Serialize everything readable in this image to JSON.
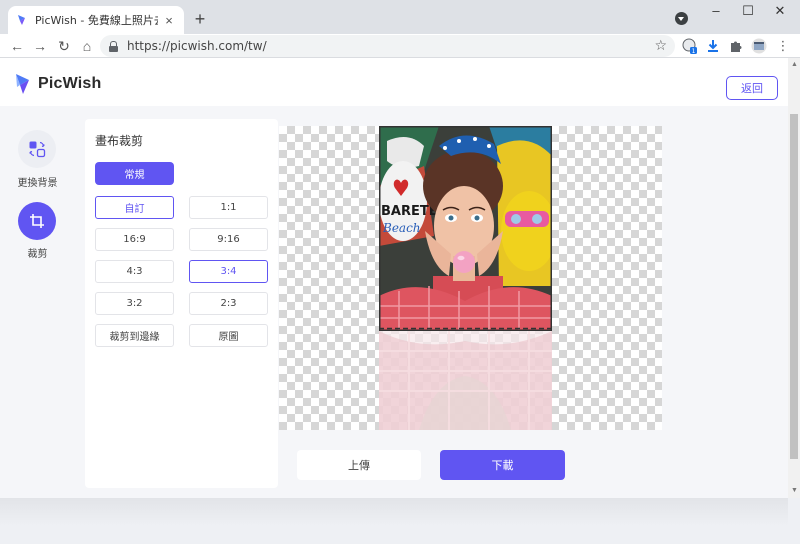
{
  "browser": {
    "tab_title": "PicWish - 免費線上照片去背，超",
    "tab_close": "×",
    "new_tab": "+",
    "url": "https://picwish.com/tw/",
    "nav": {
      "back": "←",
      "forward": "→",
      "reload": "↻",
      "home": "⌂"
    },
    "window": {
      "minimize": "–",
      "maximize": "☐",
      "close": "✕"
    },
    "star": "☆",
    "ext_badge": "1",
    "menu": "⋮"
  },
  "header": {
    "brand": "PicWish",
    "back_label": "返回",
    "accent_color": "#6055f2"
  },
  "sidebar": {
    "items": [
      {
        "label": "更換背景",
        "icon": "swap-background-icon",
        "active": false
      },
      {
        "label": "裁剪",
        "icon": "crop-icon",
        "active": true
      }
    ]
  },
  "crop_panel": {
    "title": "畫布裁剪",
    "mode_label": "常規",
    "ratios": [
      {
        "label": "自訂",
        "active": true
      },
      {
        "label": "1:1",
        "active": false
      },
      {
        "label": "16:9",
        "active": false
      },
      {
        "label": "9:16",
        "active": false
      },
      {
        "label": "4:3",
        "active": false
      },
      {
        "label": "3:4",
        "active": true
      },
      {
        "label": "3:2",
        "active": false
      },
      {
        "label": "2:3",
        "active": false
      },
      {
        "label": "裁剪到邊緣",
        "active": false
      },
      {
        "label": "原圖",
        "active": false
      }
    ]
  },
  "canvas": {
    "photo_text_line1": "BARETE",
    "photo_text_line2": "Beach"
  },
  "actions": {
    "upload_label": "上傳",
    "download_label": "下載"
  }
}
